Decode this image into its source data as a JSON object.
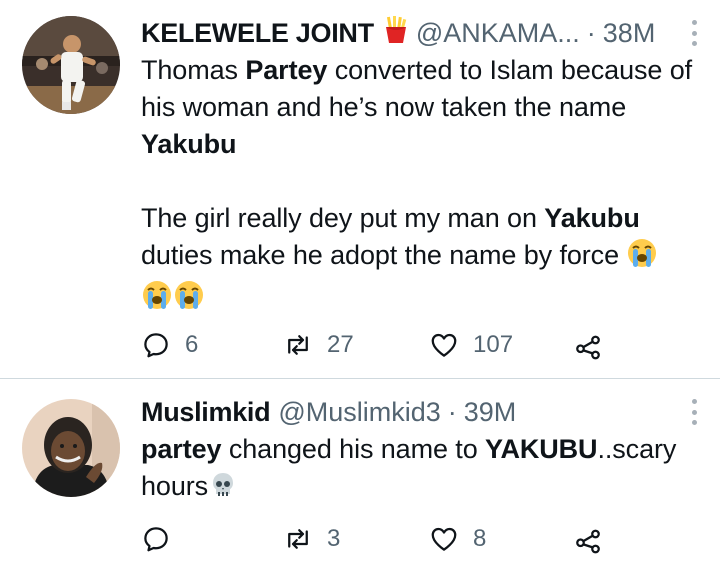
{
  "tweets": [
    {
      "name": "KELEWELE JOINT",
      "name_emoji": "fries-emoji",
      "handle": "@ANKAMA...",
      "separator": "·",
      "time": "38M",
      "body": {
        "p1_a": "Thomas ",
        "p1_b": "Partey",
        "p1_c": " converted to Islam because of his woman and he’s now taken the name ",
        "p1_d": "Yakubu",
        "p2_a": "The girl really dey put my man on ",
        "p2_b": "Yakubu",
        "p2_c": " duties make he adopt the name by force "
      },
      "emojis": [
        "loudly-crying-face-emoji",
        "loudly-crying-face-emoji",
        "loudly-crying-face-emoji"
      ],
      "replies": "6",
      "retweets": "27",
      "likes": "107"
    },
    {
      "name": "Muslimkid",
      "handle": "@Muslimkid3",
      "separator": "·",
      "time": "39M",
      "body": {
        "a": "partey",
        "b": " changed his name to ",
        "c": "YAKUBU",
        "d": "..scary hours"
      },
      "emojis": [
        "skull-emoji"
      ],
      "replies": "",
      "retweets": "3",
      "likes": "8"
    }
  ],
  "colors": {
    "text": "#0f1419",
    "secondary": "#536471",
    "divider": "#cfd9de"
  }
}
